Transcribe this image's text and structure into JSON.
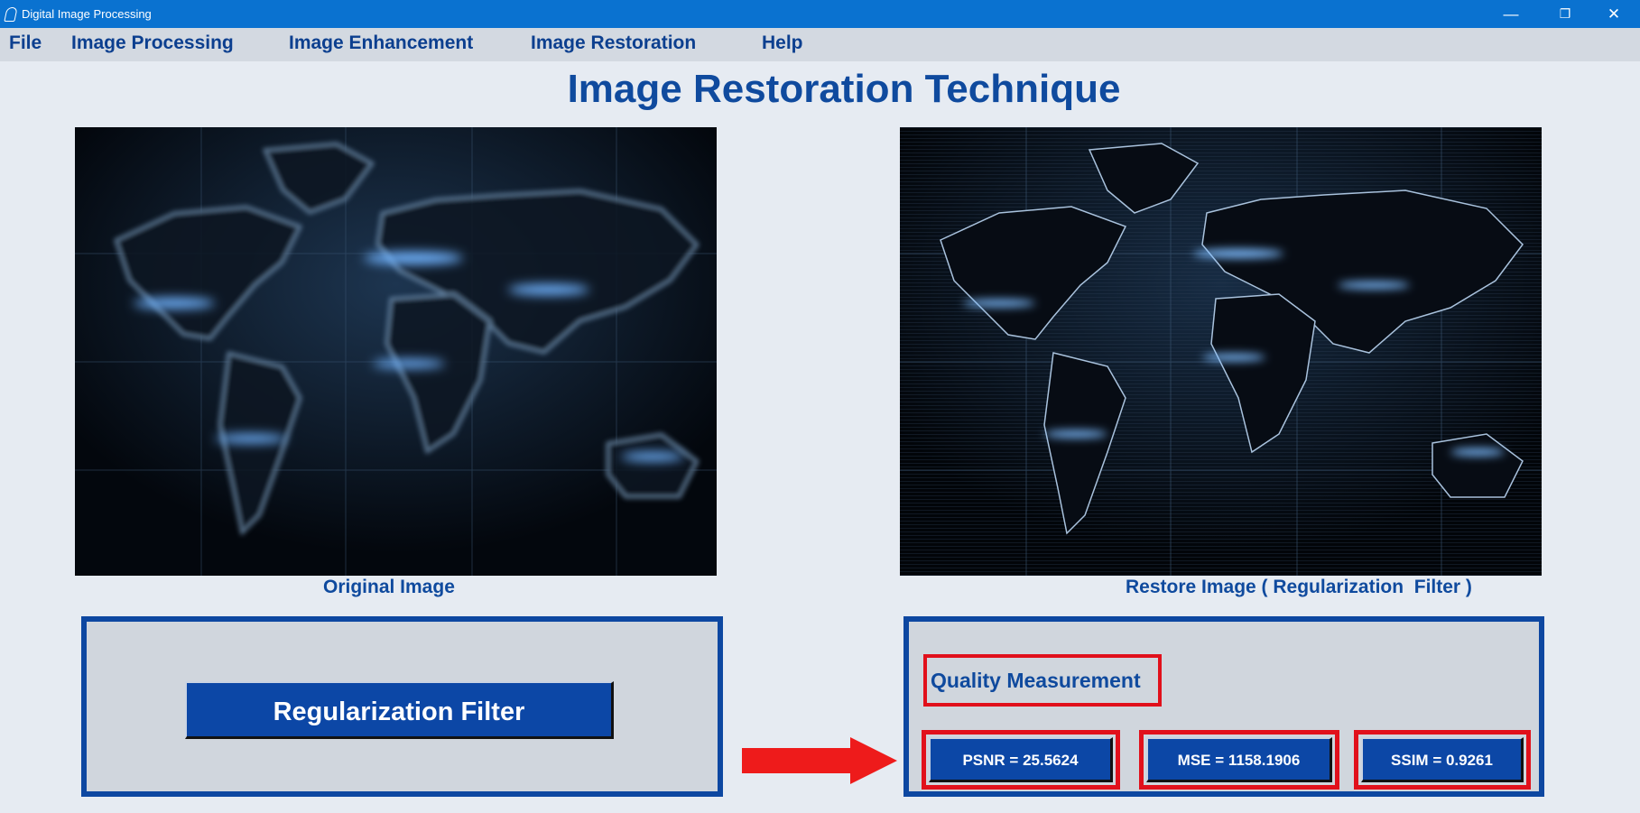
{
  "window": {
    "title": "Digital Image Processing",
    "controls": {
      "minimize": "—",
      "maximize": "❐",
      "close": "✕"
    }
  },
  "menu": [
    {
      "label": "File"
    },
    {
      "label": "Image Processing"
    },
    {
      "label": "Image Enhancement"
    },
    {
      "label": "Image Restoration"
    },
    {
      "label": "Help"
    }
  ],
  "page_title": "Image Restoration Technique",
  "original_panel": {
    "caption": "Original Image",
    "image": "world-map-blurred"
  },
  "restored_panel": {
    "caption": "Restore Image ( Regularization  Filter )",
    "image": "world-map-restored"
  },
  "filter_button": {
    "label": "Regularization Filter"
  },
  "quality": {
    "label": "Quality Measurement",
    "metrics": [
      {
        "text": "PSNR = 25.5624"
      },
      {
        "text": "MSE = 1158.1906"
      },
      {
        "text": "SSIM = 0.9261"
      }
    ]
  },
  "colors": {
    "accent": "#0f4a9e",
    "button": "#0c47a6",
    "highlight": "#e1101b",
    "titlebar": "#0a72d0"
  }
}
